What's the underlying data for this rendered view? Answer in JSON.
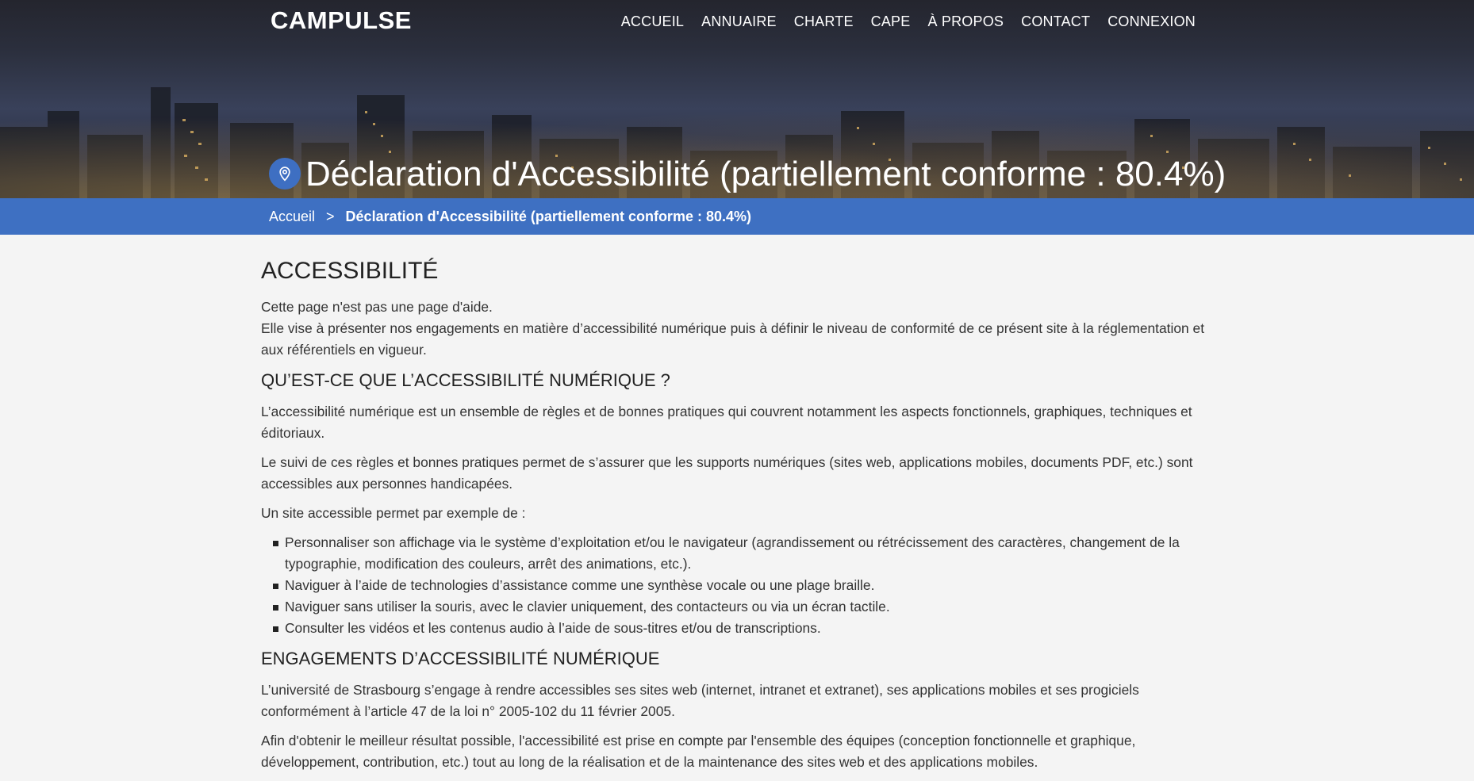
{
  "header": {
    "logo": "CAMPULSE",
    "nav": [
      "ACCUEIL",
      "ANNUAIRE",
      "CHARTE",
      "CAPE",
      "À PROPOS",
      "CONTACT",
      "CONNEXION"
    ],
    "page_title": "Déclaration d'Accessibilité (partiellement conforme : 80.4%)",
    "title_icon": "location-pin-icon"
  },
  "breadcrumb": {
    "home": "Accueil",
    "separator": ">",
    "current": "Déclaration d'Accessibilité (partiellement conforme : 80.4%)"
  },
  "colors": {
    "accent": "#3e70c2",
    "background": "#f4f4f4",
    "text": "#333333"
  },
  "content": {
    "h1": "ACCESSIBILITÉ",
    "intro_1": "Cette page n'est pas une page d'aide.",
    "intro_2": "Elle vise à présenter nos engagements en matière d’accessibilité numérique puis à définir le niveau de conformité de ce présent site à la réglementation et aux référentiels en vigueur.",
    "h2_1": "QU’EST-CE QUE L’ACCESSIBILITÉ NUMÉRIQUE ?",
    "p_1": "L’accessibilité numérique est un ensemble de règles et de bonnes pratiques qui couvrent notamment les aspects fonctionnels, graphiques, techniques et éditoriaux.",
    "p_2": "Le suivi de ces règles et bonnes pratiques permet de s’assurer que les supports numériques (sites web, applications mobiles, documents PDF, etc.) sont accessibles aux personnes handicapées.",
    "p_3": "Un site accessible permet par exemple de :",
    "list": [
      "Personnaliser son affichage via le système d’exploitation et/ou le navigateur (agrandissement ou rétrécissement des caractères, changement de la typographie, modification des couleurs, arrêt des animations, etc.).",
      "Naviguer à l’aide de technologies d’assistance comme une synthèse vocale ou une plage braille.",
      "Naviguer sans utiliser la souris, avec le clavier uniquement, des contacteurs ou via un écran tactile.",
      "Consulter les vidéos et les contenus audio à l’aide de sous-titres et/ou de transcriptions."
    ],
    "h2_2": "ENGAGEMENTS D’ACCESSIBILITÉ NUMÉRIQUE",
    "p_4": "L’université de Strasbourg s’engage à rendre accessibles ses sites web (internet, intranet et extranet), ses applications mobiles et ses progiciels conformément à l’article 47 de la loi n° 2005-102 du 11 février 2005.",
    "p_5": "Afin d'obtenir le meilleur résultat possible, l'accessibilité est prise en compte par l'ensemble des équipes (conception fonctionnelle et graphique, développement, contribution, etc.) tout au long de la réalisation et de la maintenance des sites web et des applications mobiles."
  }
}
